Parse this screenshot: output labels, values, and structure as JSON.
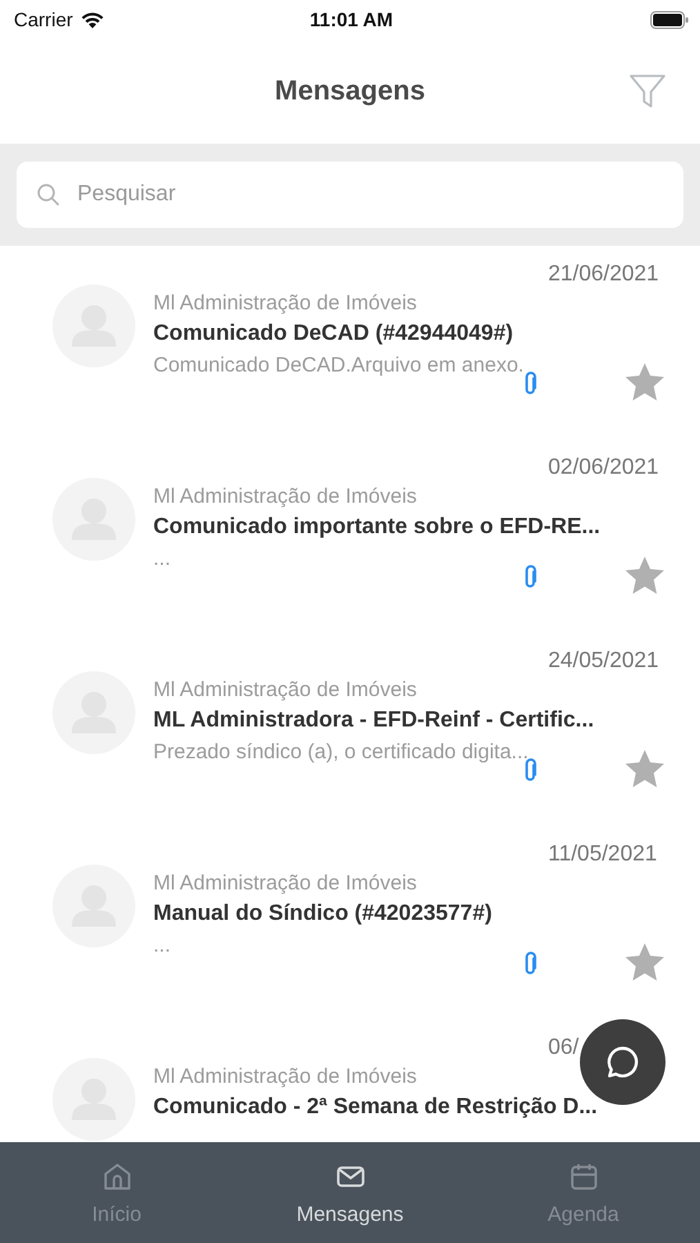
{
  "status_bar": {
    "carrier": "Carrier",
    "time": "11:01 AM"
  },
  "header": {
    "title": "Mensagens"
  },
  "search": {
    "placeholder": "Pesquisar"
  },
  "messages": [
    {
      "date": "21/06/2021",
      "sender": "Ml Administração de Imóveis",
      "subject": "Comunicado DeCAD (#42944049#)",
      "preview": "Comunicado DeCAD.Arquivo em anexo.",
      "attachment": true,
      "starred": false
    },
    {
      "date": "02/06/2021",
      "sender": "Ml Administração de Imóveis",
      "subject": "Comunicado importante sobre o EFD-RE...",
      "preview": "...",
      "attachment": true,
      "starred": false
    },
    {
      "date": "24/05/2021",
      "sender": "Ml Administração de Imóveis",
      "subject": "ML Administradora - EFD-Reinf - Certific...",
      "preview": "Prezado síndico (a), o certificado digita...",
      "attachment": true,
      "starred": false
    },
    {
      "date": "11/05/2021",
      "sender": "Ml Administração de Imóveis",
      "subject": "Manual do Síndico (#42023577#)",
      "preview": "...",
      "attachment": true,
      "starred": false
    },
    {
      "date": "06/",
      "sender": "Ml Administração de Imóveis",
      "subject": "Comunicado - 2ª Semana de Restrição D..."
    }
  ],
  "tabs": [
    {
      "label": "Início",
      "kind": "home",
      "selected": false
    },
    {
      "label": "Mensagens",
      "kind": "mail",
      "selected": true
    },
    {
      "label": "Agenda",
      "kind": "calendar",
      "selected": false
    }
  ]
}
